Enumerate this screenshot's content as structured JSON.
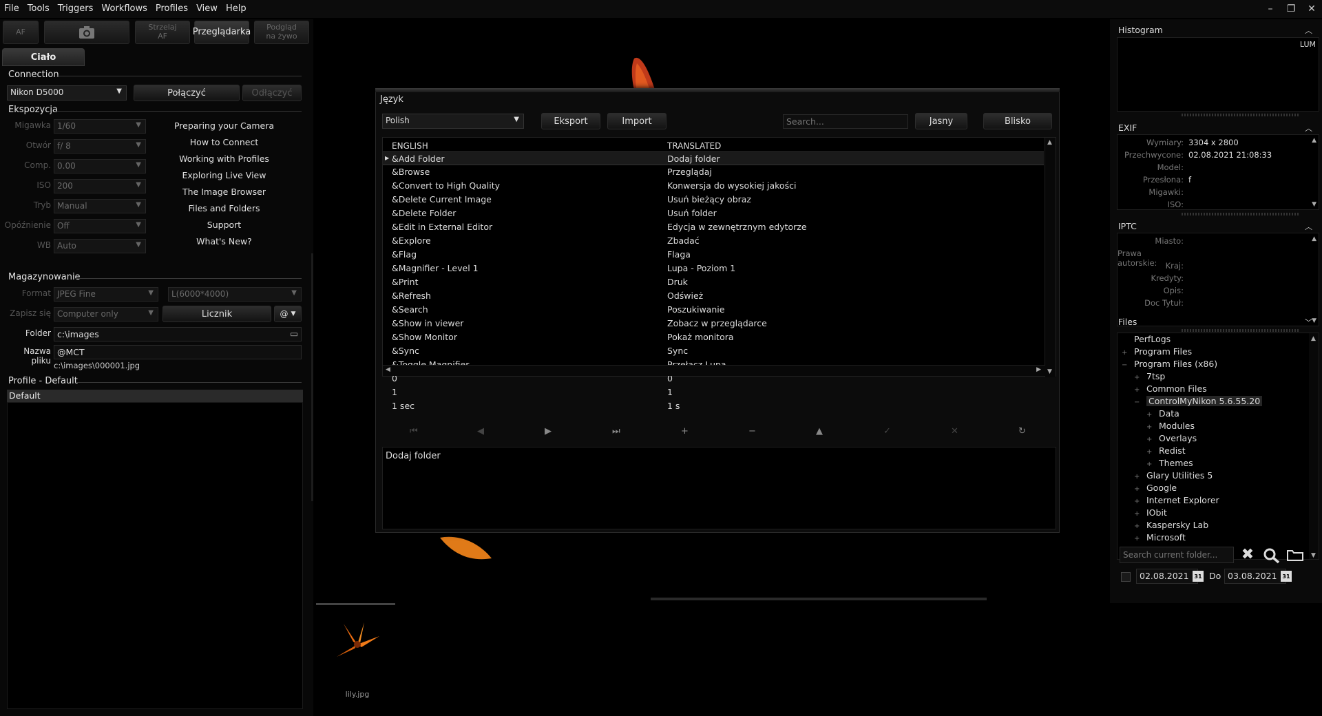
{
  "menu": [
    "File",
    "Tools",
    "Triggers",
    "Workflows",
    "Profiles",
    "View",
    "Help"
  ],
  "window_controls": [
    "–",
    "❐",
    "✕"
  ],
  "top_buttons": {
    "af": "AF",
    "camera_icon": "camera-icon",
    "shoot_af_l1": "Strzelaj",
    "shoot_af_l2": "AF",
    "browser": "Przeglądarka",
    "live_l1": "Podgląd",
    "live_l2": "na żywo"
  },
  "tab": "Ciało",
  "connection": {
    "title": "Connection",
    "camera": "Nikon D5000",
    "connect": "Połączyć",
    "disconnect": "Odłączyć"
  },
  "exposure": {
    "title": "Ekspozycja",
    "fields": [
      {
        "label": "Migawka",
        "value": "1/60"
      },
      {
        "label": "Otwór",
        "value": "f/ 8"
      },
      {
        "label": "Comp.",
        "value": "0.00"
      },
      {
        "label": "ISO",
        "value": "200"
      },
      {
        "label": "Tryb",
        "value": "Manual"
      },
      {
        "label": "Opóźnienie",
        "value": "Off"
      },
      {
        "label": "WB",
        "value": "Auto"
      }
    ]
  },
  "help_links": [
    "Preparing your Camera",
    "How to Connect",
    "Working with Profiles",
    "Exploring Live View",
    "The Image Browser",
    "Files and Folders",
    "Support",
    "What's New?"
  ],
  "storage": {
    "title": "Magazynowanie",
    "format_label": "Format",
    "format": "JPEG Fine",
    "size": "L(6000*4000)",
    "save_label": "Zapisz się",
    "save": "Computer only",
    "counter": "Licznik",
    "at": "@",
    "folder_label": "Folder",
    "folder": "c:\\images",
    "filename_label": "Nazwa pliku",
    "filename": "@MCT",
    "path_preview": "c:\\images\\000001.jpg"
  },
  "profile": {
    "title": "Profile - Default",
    "items": [
      "Default"
    ]
  },
  "dialog": {
    "title": "Język",
    "language": "Polish",
    "export": "Eksport",
    "import": "Import",
    "search_placeholder": "Search...",
    "light": "Jasny",
    "close": "Blisko",
    "col_english": "ENGLISH",
    "col_translated": "TRANSLATED",
    "rows": [
      {
        "en": "&Add Folder",
        "tr": "Dodaj folder"
      },
      {
        "en": "&Browse",
        "tr": "Przeglądaj"
      },
      {
        "en": "&Convert to High Quality",
        "tr": "Konwersja do wysokiej jakości"
      },
      {
        "en": "&Delete Current Image",
        "tr": "Usuń bieżący obraz"
      },
      {
        "en": "&Delete Folder",
        "tr": "Usuń folder"
      },
      {
        "en": "&Edit in External Editor",
        "tr": "Edycja w zewnętrznym edytorze"
      },
      {
        "en": "&Explore",
        "tr": "Zbadać"
      },
      {
        "en": "&Flag",
        "tr": "Flaga"
      },
      {
        "en": "&Magnifier - Level 1",
        "tr": "Lupa - Poziom 1"
      },
      {
        "en": "&Print",
        "tr": "Druk"
      },
      {
        "en": "&Refresh",
        "tr": "Odśwież"
      },
      {
        "en": "&Search",
        "tr": "Poszukiwanie"
      },
      {
        "en": "&Show in viewer",
        "tr": "Zobacz w przeglądarce"
      },
      {
        "en": "&Show Monitor",
        "tr": "Pokaż monitora"
      },
      {
        "en": "&Sync",
        "tr": "Sync"
      },
      {
        "en": "&Toggle Magnifier",
        "tr": "Przełącz Lupa"
      },
      {
        "en": "0",
        "tr": "0"
      },
      {
        "en": "1",
        "tr": "1"
      },
      {
        "en": "1 sec",
        "tr": "1 s"
      }
    ],
    "nav_icons": [
      "⏮",
      "◀",
      "▶",
      "⏭",
      "+",
      "−",
      "▲",
      "✓",
      "✕",
      "↻"
    ],
    "notes": "Dodaj folder"
  },
  "histogram": {
    "title": "Histogram",
    "mode": "LUM"
  },
  "exif": {
    "title": "EXIF",
    "rows": [
      {
        "k": "Wymiary:",
        "v": "3304 x 2800"
      },
      {
        "k": "Przechwycone:",
        "v": "02.08.2021 21:08:33"
      },
      {
        "k": "Model:",
        "v": ""
      },
      {
        "k": "Przesłona:",
        "v": "f"
      },
      {
        "k": "Migawki:",
        "v": ""
      },
      {
        "k": "ISO:",
        "v": ""
      }
    ]
  },
  "iptc": {
    "title": "IPTC",
    "rows": [
      {
        "k": "Miasto:",
        "v": ""
      },
      {
        "k": "Prawa autorskie:",
        "v": ""
      },
      {
        "k": "Kraj:",
        "v": ""
      },
      {
        "k": "Kredyty:",
        "v": ""
      },
      {
        "k": "Opis:",
        "v": ""
      },
      {
        "k": "Doc Tytuł:",
        "v": ""
      }
    ]
  },
  "files": {
    "title": "Files",
    "tree": [
      {
        "label": "PerfLogs",
        "depth": 1,
        "sign": ""
      },
      {
        "label": "Program Files",
        "depth": 1,
        "sign": "+"
      },
      {
        "label": "Program Files (x86)",
        "depth": 1,
        "sign": "−"
      },
      {
        "label": "7tsp",
        "depth": 2,
        "sign": "+"
      },
      {
        "label": "Common Files",
        "depth": 2,
        "sign": "+"
      },
      {
        "label": "ControlMyNikon 5.6.55.20",
        "depth": 2,
        "sign": "−"
      },
      {
        "label": "Data",
        "depth": 3,
        "sign": "+"
      },
      {
        "label": "Modules",
        "depth": 3,
        "sign": "+"
      },
      {
        "label": "Overlays",
        "depth": 3,
        "sign": "+"
      },
      {
        "label": "Redist",
        "depth": 3,
        "sign": "+"
      },
      {
        "label": "Themes",
        "depth": 3,
        "sign": "+"
      },
      {
        "label": "Glary Utilities 5",
        "depth": 2,
        "sign": "+"
      },
      {
        "label": "Google",
        "depth": 2,
        "sign": "+"
      },
      {
        "label": "Internet Explorer",
        "depth": 2,
        "sign": "+"
      },
      {
        "label": "IObit",
        "depth": 2,
        "sign": "+"
      },
      {
        "label": "Kaspersky Lab",
        "depth": 2,
        "sign": "+"
      },
      {
        "label": "Microsoft",
        "depth": 2,
        "sign": "+"
      }
    ],
    "search_placeholder": "Search current folder...",
    "date_from": "02.08.2021",
    "to_label": "Do",
    "date_to": "03.08.2021",
    "cal": "31"
  },
  "filmstrip": {
    "items": [
      {
        "name": "lily.jpg"
      }
    ]
  }
}
